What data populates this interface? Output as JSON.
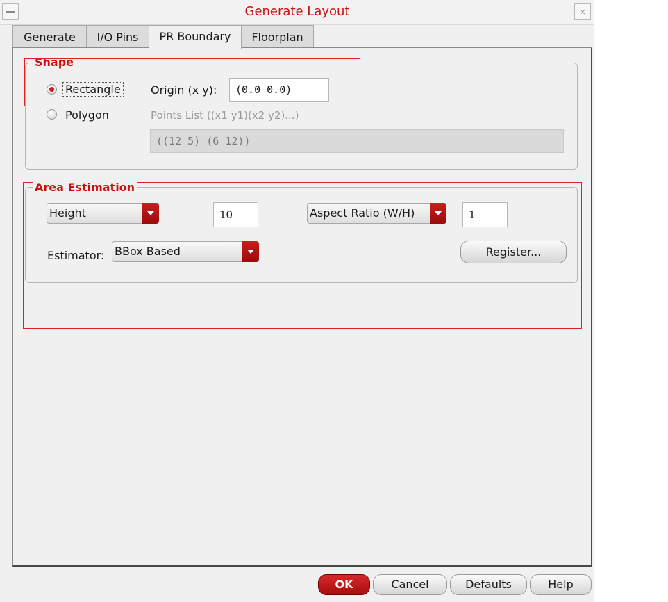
{
  "window": {
    "title": "Generate Layout",
    "close_glyph": "⨯"
  },
  "tabs": [
    {
      "label": "Generate"
    },
    {
      "label": "I/O Pins"
    },
    {
      "label": "PR Boundary",
      "active": true
    },
    {
      "label": "Floorplan"
    }
  ],
  "shape": {
    "legend": "Shape",
    "rectangle_label": "Rectangle",
    "rectangle_selected": true,
    "origin_label": "Origin (x y):",
    "origin_value": "(0.0 0.0)",
    "polygon_label": "Polygon",
    "points_label": "Points List ((x1 y1)(x2 y2)...)",
    "points_value": "((12 5) (6 12))"
  },
  "area": {
    "legend": "Area Estimation",
    "dimension_select": "Height",
    "dimension_value": "10",
    "ratio_select": "Aspect Ratio (W/H)",
    "ratio_value": "1",
    "estimator_label": "Estimator:",
    "estimator_select": "BBox Based",
    "register_label": "Register..."
  },
  "buttons": {
    "ok": "OK",
    "cancel": "Cancel",
    "defaults": "Defaults",
    "help": "Help"
  },
  "colors": {
    "accent": "#cc1111",
    "highlight_box": "#e02020"
  }
}
